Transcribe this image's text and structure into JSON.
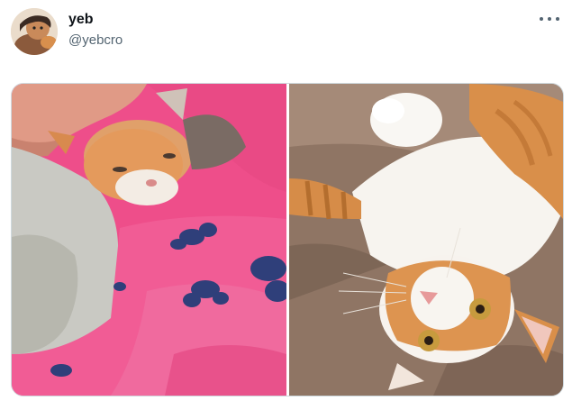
{
  "tweet": {
    "display_name": "yeb",
    "handle": "@yebcro",
    "more_icon": "more-horizontal-icon",
    "avatar_icon": "avatar-image"
  },
  "media": {
    "photos": [
      {
        "id": "photo-1",
        "subject": "orange-white-kitten-on-pink-blanket"
      },
      {
        "id": "photo-2",
        "subject": "orange-white-cat-upside-down-on-couch"
      }
    ]
  },
  "colors": {
    "name_text": "#0f1419",
    "secondary_text": "#536471",
    "border": "#cfd9de",
    "blanket_pink": "#ef4f8a",
    "couch_brown": "#8f7564",
    "cat_orange": "#d98f4a"
  }
}
